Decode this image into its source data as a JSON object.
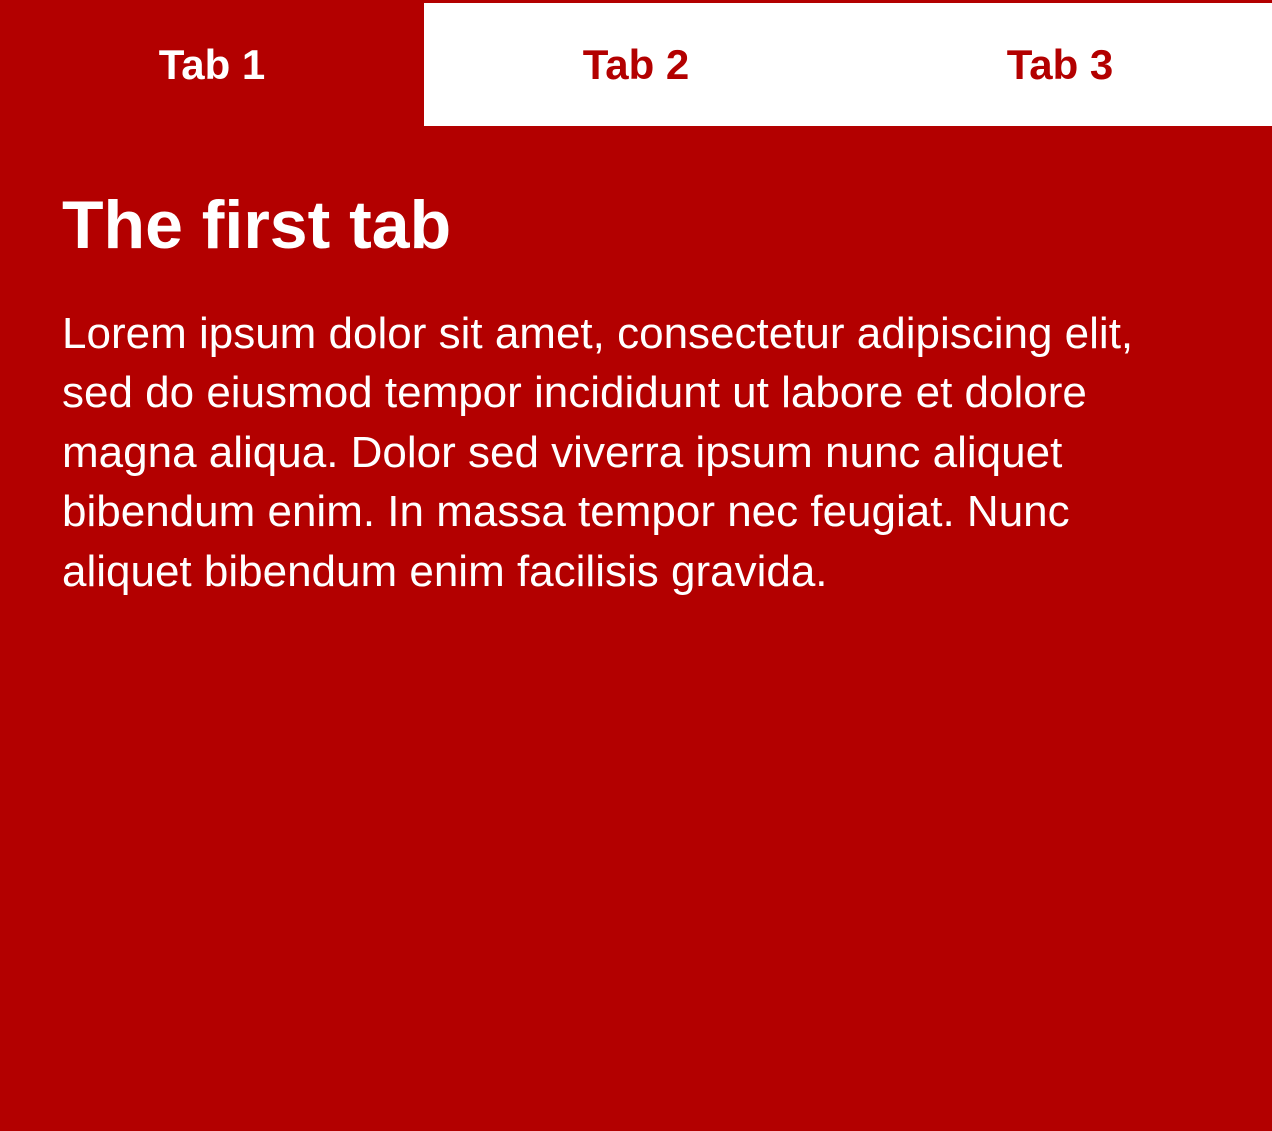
{
  "colors": {
    "accent": "#b30000",
    "on_accent": "#ffffff"
  },
  "tabs": {
    "items": [
      {
        "label": "Tab 1",
        "active": true
      },
      {
        "label": "Tab 2",
        "active": false
      },
      {
        "label": "Tab 3",
        "active": false
      }
    ]
  },
  "panel": {
    "title": "The first tab",
    "body": "Lorem ipsum dolor sit amet, consectetur adipi­scing elit, sed do eiusmod tempor incididunt ut labore et dolore magna aliqua. Dolor sed viver­ra ipsum nunc aliquet bibendum enim. In mas­sa tempor nec feugiat. Nunc aliquet bibendum enim facilisis gravida."
  }
}
